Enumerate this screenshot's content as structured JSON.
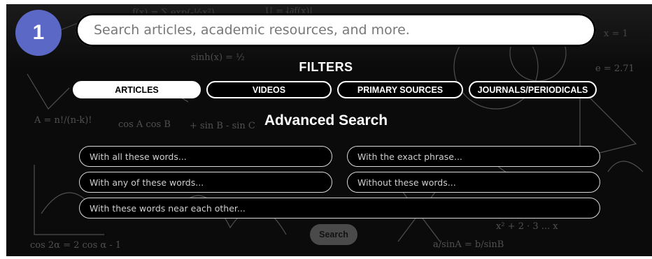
{
  "step_badge": "1",
  "search": {
    "placeholder": "Search articles, academic resources, and more.",
    "value": ""
  },
  "filters": {
    "title": "FILTERS",
    "items": [
      {
        "label": "ARTICLES",
        "active": true
      },
      {
        "label": "VIDEOS",
        "active": false
      },
      {
        "label": "PRIMARY SOURCES",
        "active": false
      },
      {
        "label": "JOURNALS/PERIODICALS",
        "active": false
      }
    ]
  },
  "advanced": {
    "title": "Advanced Search",
    "fields": {
      "all_words": "With all these words...",
      "exact_phrase": "With the exact phrase...",
      "any_words": "With any of these words...",
      "without_words": "Without these words...",
      "near_words": "With these words near each other..."
    },
    "search_label": "Search"
  },
  "colors": {
    "badge": "#5b68c6",
    "background": "#0b0b0b",
    "active_filter": "#ffffff",
    "search_button": "#4a4a4a"
  }
}
